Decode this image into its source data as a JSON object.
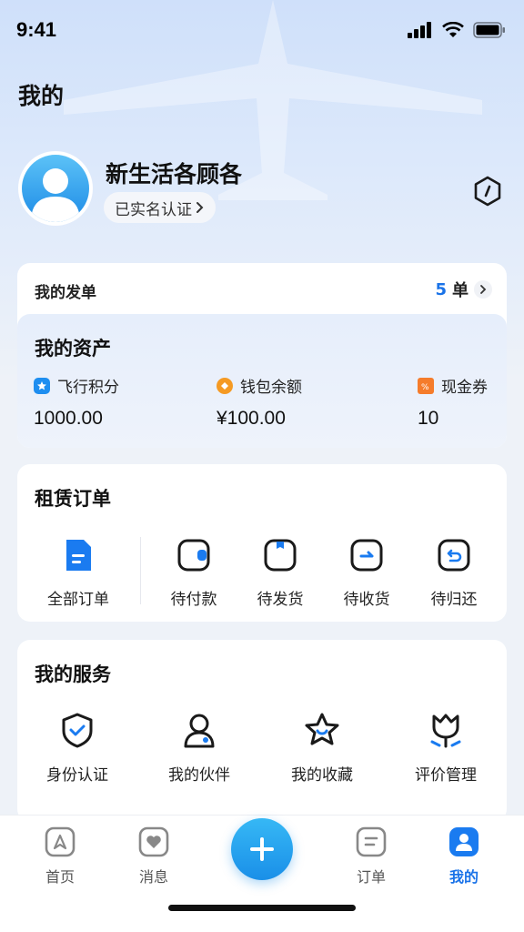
{
  "status_bar": {
    "time": "9:41"
  },
  "page_title": "我的",
  "profile": {
    "name": "新生活各顾各",
    "verify_label": "已实名认证"
  },
  "orders_issued": {
    "label": "我的发单",
    "count": "5",
    "unit": "单"
  },
  "assets": {
    "title": "我的资产",
    "items": [
      {
        "label": "飞行积分",
        "value": "1000.00",
        "icon": "star-badge-icon",
        "color": "#1e8ef0"
      },
      {
        "label": "钱包余额",
        "value": "¥100.00",
        "icon": "wallet-diamond-icon",
        "color": "#f59a23"
      },
      {
        "label": "现金券",
        "value": "10",
        "icon": "coupon-icon",
        "color": "#f57c2b"
      }
    ]
  },
  "rental_orders": {
    "title": "租赁订单",
    "items": [
      {
        "label": "全部订单",
        "icon": "document-icon"
      },
      {
        "label": "待付款",
        "icon": "wallet-icon"
      },
      {
        "label": "待发货",
        "icon": "box-icon"
      },
      {
        "label": "待收货",
        "icon": "receive-icon"
      },
      {
        "label": "待归还",
        "icon": "return-icon"
      }
    ]
  },
  "services": {
    "title": "我的服务",
    "items": [
      {
        "label": "身份认证",
        "icon": "shield-check-icon"
      },
      {
        "label": "我的伙伴",
        "icon": "person-icon"
      },
      {
        "label": "我的收藏",
        "icon": "star-icon"
      },
      {
        "label": "评价管理",
        "icon": "tulip-icon"
      }
    ]
  },
  "tab_bar": {
    "items": [
      {
        "label": "首页",
        "icon": "home-icon",
        "active": false
      },
      {
        "label": "消息",
        "icon": "message-heart-icon",
        "active": false
      },
      {
        "label": "订单",
        "icon": "order-list-icon",
        "active": false
      },
      {
        "label": "我的",
        "icon": "profile-icon",
        "active": true
      }
    ],
    "center_action": "plus-icon"
  },
  "colors": {
    "accent": "#1a73e8",
    "fab": "#1a8fe8"
  }
}
